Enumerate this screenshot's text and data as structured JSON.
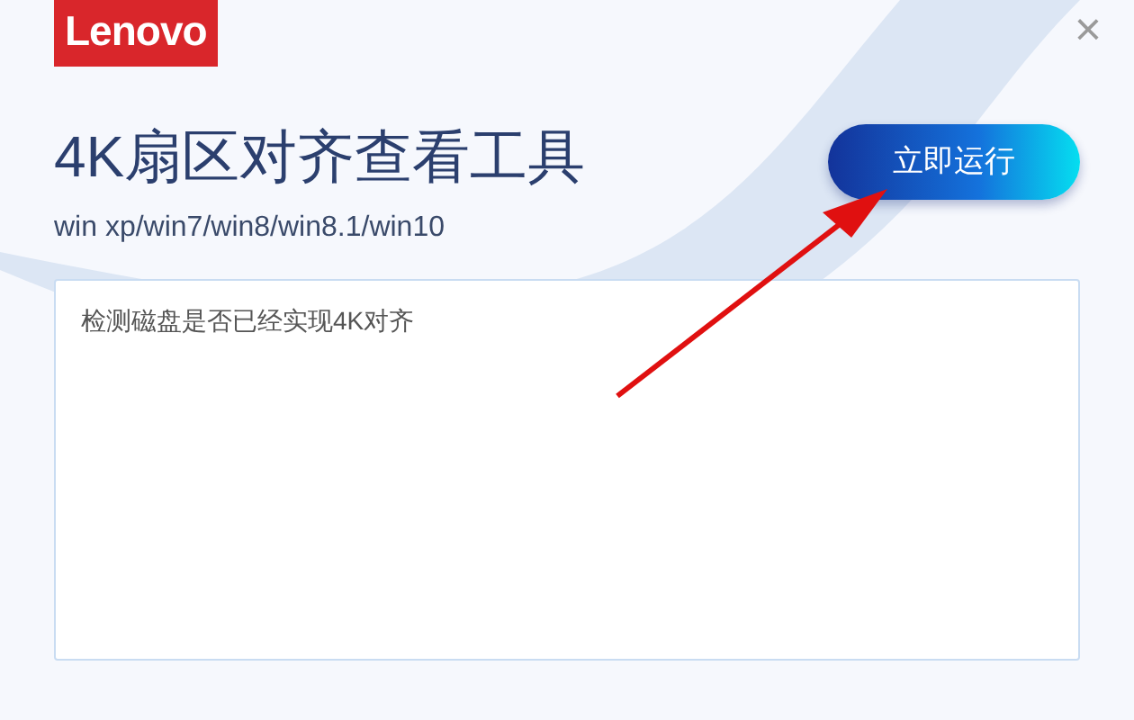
{
  "logo": "Lenovo",
  "title": "4K扇区对齐查看工具",
  "subtitle": "win xp/win7/win8/win8.1/win10",
  "run_button": "立即运行",
  "close": "×",
  "output": {
    "text": "检测磁盘是否已经实现4K对齐"
  }
}
